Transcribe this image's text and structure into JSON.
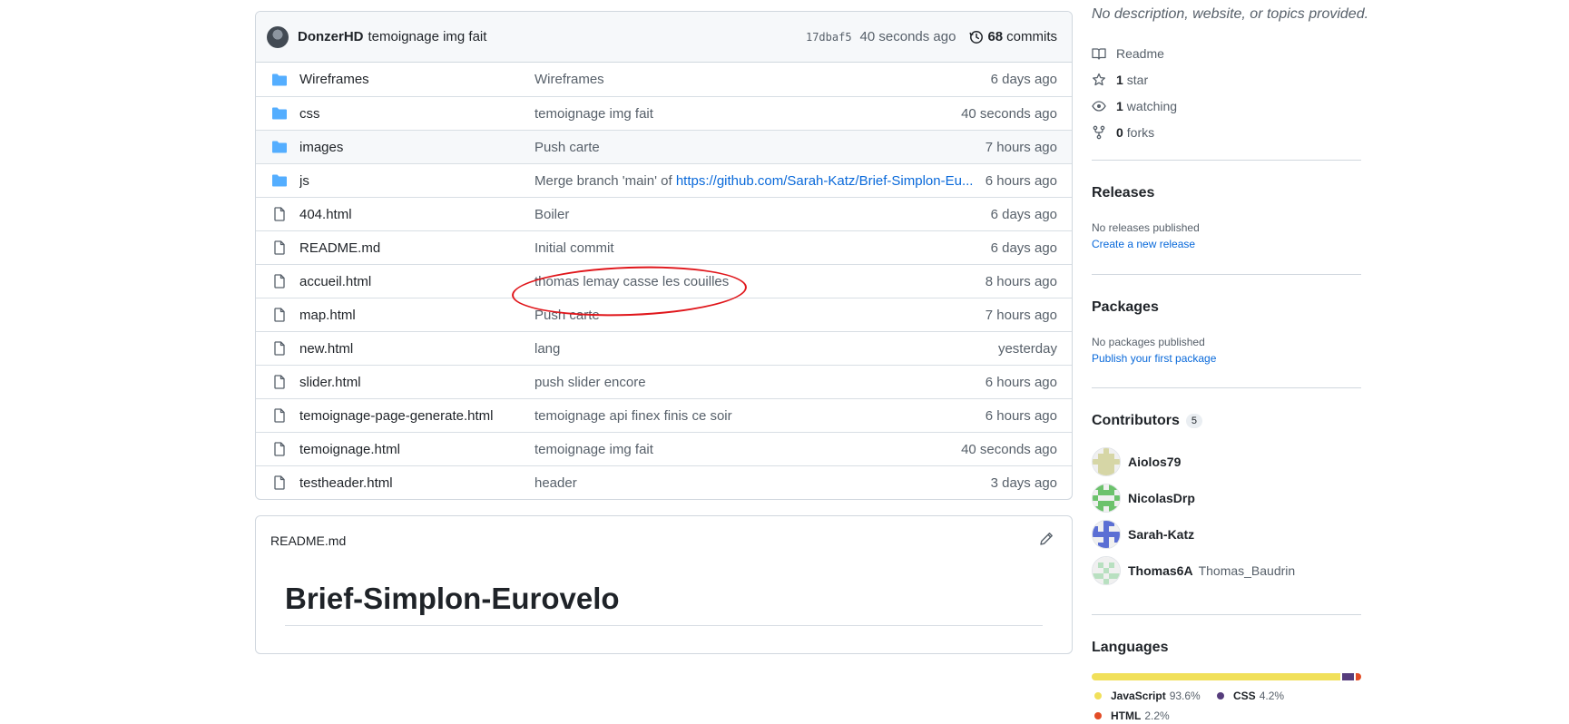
{
  "latest_commit": {
    "author": "DonzerHD",
    "message": "temoignage img fait",
    "sha": "17dbaf5",
    "time": "40 seconds ago",
    "commit_count": "68",
    "commit_label": "commits"
  },
  "files": [
    {
      "type": "folder",
      "name": "Wireframes",
      "commit": "Wireframes",
      "age": "6 days ago"
    },
    {
      "type": "folder",
      "name": "css",
      "commit": "temoignage img fait",
      "age": "40 seconds ago"
    },
    {
      "type": "folder",
      "name": "images",
      "commit": "Push carte",
      "age": "7 hours ago"
    },
    {
      "type": "folder",
      "name": "js",
      "commit": "Merge branch 'main' of ",
      "commit_link": "https://github.com/Sarah-Katz/Brief-Simplon-Eu...",
      "age": "6 hours ago"
    },
    {
      "type": "file",
      "name": "404.html",
      "commit": "Boiler",
      "age": "6 days ago"
    },
    {
      "type": "file",
      "name": "README.md",
      "commit": "Initial commit",
      "age": "6 days ago"
    },
    {
      "type": "file",
      "name": "accueil.html",
      "commit": "thomas lemay casse les couilles",
      "age": "8 hours ago"
    },
    {
      "type": "file",
      "name": "map.html",
      "commit": "Push carte",
      "age": "7 hours ago"
    },
    {
      "type": "file",
      "name": "new.html",
      "commit": "lang",
      "age": "yesterday"
    },
    {
      "type": "file",
      "name": "slider.html",
      "commit": "push slider encore",
      "age": "6 hours ago"
    },
    {
      "type": "file",
      "name": "temoignage-page-generate.html",
      "commit": "temoignage api finex finis ce soir",
      "age": "6 hours ago"
    },
    {
      "type": "file",
      "name": "temoignage.html",
      "commit": "temoignage img fait",
      "age": "40 seconds ago"
    },
    {
      "type": "file",
      "name": "testheader.html",
      "commit": "header",
      "age": "3 days ago"
    }
  ],
  "readme": {
    "filename": "README.md",
    "heading": "Brief-Simplon-Eurovelo"
  },
  "about": {
    "description": "No description, website, or topics provided.",
    "readme_label": "Readme",
    "stars_count": "1",
    "stars_label": "star",
    "watching_count": "1",
    "watching_label": "watching",
    "forks_count": "0",
    "forks_label": "forks"
  },
  "releases": {
    "title": "Releases",
    "empty_text": "No releases published",
    "create_link": "Create a new release"
  },
  "packages": {
    "title": "Packages",
    "empty_text": "No packages published",
    "publish_link": "Publish your first package"
  },
  "contributors": {
    "title": "Contributors",
    "count": "5",
    "list": [
      {
        "login": "Aiolos79",
        "name": ""
      },
      {
        "login": "NicolasDrp",
        "name": ""
      },
      {
        "login": "Sarah-Katz",
        "name": ""
      },
      {
        "login": "Thomas6A",
        "name": "Thomas_Baudrin"
      }
    ]
  },
  "languages": {
    "title": "Languages",
    "list": [
      {
        "name": "JavaScript",
        "percent": "93.6%",
        "value": 93.6,
        "color": "#f1e05a"
      },
      {
        "name": "CSS",
        "percent": "4.2%",
        "value": 4.2,
        "color": "#563d7c"
      },
      {
        "name": "HTML",
        "percent": "2.2%",
        "value": 2.2,
        "color": "#e34c26"
      }
    ]
  },
  "colors": {
    "link": "#0969da",
    "folder": "#54aeff",
    "annotation": "#e0161b"
  }
}
